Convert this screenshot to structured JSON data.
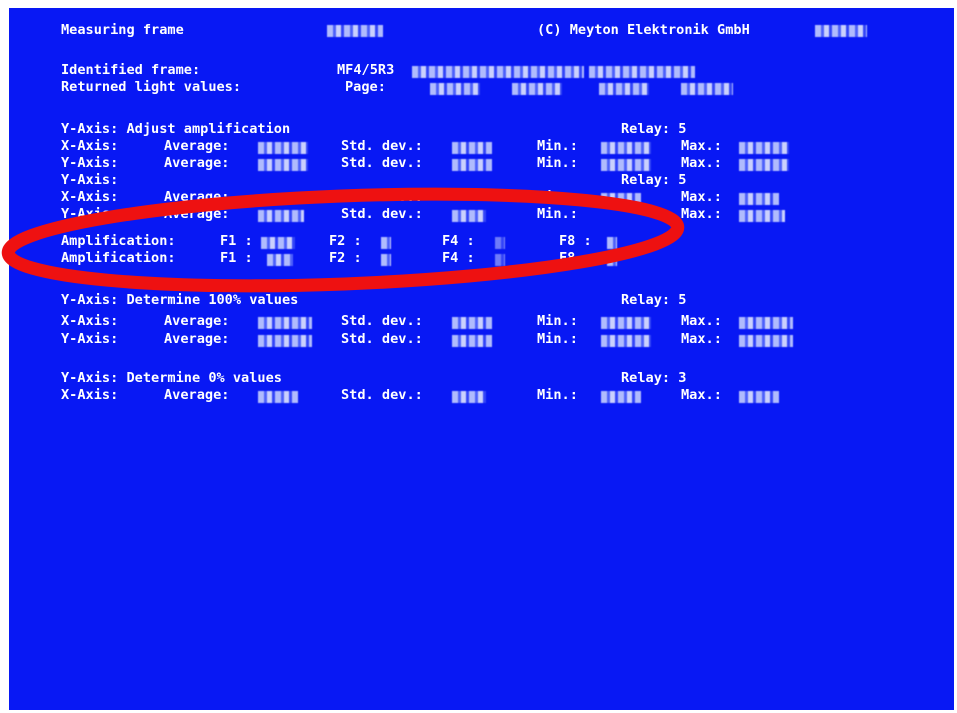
{
  "header": {
    "title": "Measuring frame",
    "copyright": "(C) Meyton Elektronik GmbH"
  },
  "identified_frame": {
    "label": "Identified frame:",
    "value": "MF4/5R3"
  },
  "returned_light_values": {
    "label": "Returned light values:",
    "page_label": "Page:"
  },
  "section_amplification": {
    "title": "Y-Axis: Adjust amplification",
    "relay": "Relay: 5",
    "rows": [
      {
        "axis": "X-Axis:",
        "avg_label": "Average:",
        "std_label": "Std. dev.:",
        "min_label": "Min.:",
        "max_label": "Max.:"
      },
      {
        "axis": "Y-Axis:",
        "avg_label": "Average:",
        "std_label": "Std. dev.:",
        "min_label": "Min.:",
        "max_label": "Max.:"
      }
    ]
  },
  "section_second": {
    "title": "Y-Axis:",
    "relay": "Relay: 5",
    "rows": [
      {
        "axis": "X-Axis:",
        "avg_label": "Average:",
        "std_label": "Std. dev.:",
        "min_label": "Min.:",
        "max_label": "Max.:"
      },
      {
        "axis": "Y-Axis:",
        "avg_label": "Average:",
        "std_label": "Std. dev.:",
        "min_label": "Min.:",
        "max_label": "Max.:"
      }
    ],
    "amplification_label": "Amplification:",
    "amp_f1": "F1 :",
    "amp_f2": "F2 :",
    "amp_f4": "F4 :",
    "amp_f8": "F8 :"
  },
  "section_hundred": {
    "title": "Y-Axis: Determine 100% values",
    "relay": "Relay: 5",
    "rows": [
      {
        "axis": "X-Axis:",
        "avg_label": "Average:",
        "std_label": "Std. dev.:",
        "min_label": "Min.:",
        "max_label": "Max.:"
      },
      {
        "axis": "Y-Axis:",
        "avg_label": "Average:",
        "std_label": "Std. dev.:",
        "min_label": "Min.:",
        "max_label": "Max.:"
      }
    ]
  },
  "section_zero": {
    "title": "Y-Axis: Determine 0% values",
    "relay": "Relay: 3",
    "rows": [
      {
        "axis": "X-Axis:",
        "avg_label": "Average:",
        "std_label": "Std. dev.:",
        "min_label": "Min.:",
        "max_label": "Max.:"
      }
    ]
  },
  "colors": {
    "screen_background": "#0818f4",
    "text": "#ffffff",
    "highlight_ellipse": "#ee1111"
  }
}
